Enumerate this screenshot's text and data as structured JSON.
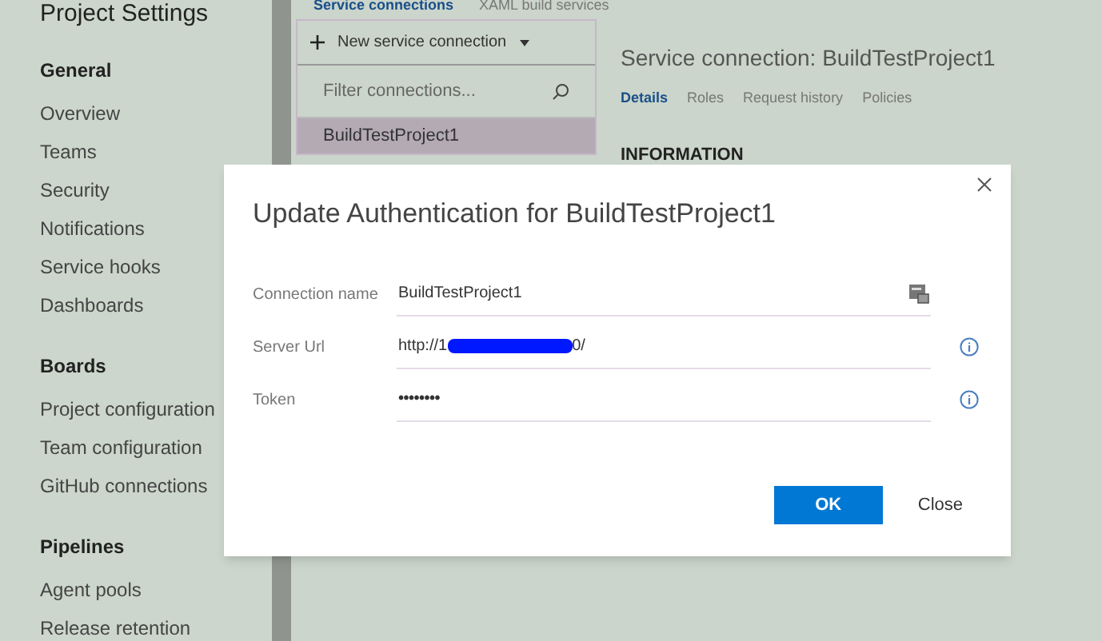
{
  "sidebar": {
    "title": "Project Settings",
    "sections": [
      {
        "heading": "General",
        "items": [
          "Overview",
          "Teams",
          "Security",
          "Notifications",
          "Service hooks",
          "Dashboards"
        ]
      },
      {
        "heading": "Boards",
        "items": [
          "Project configuration",
          "Team configuration",
          "GitHub connections"
        ]
      },
      {
        "heading": "Pipelines",
        "items": [
          "Agent pools",
          "Release retention"
        ]
      }
    ]
  },
  "top_tabs": [
    {
      "label": "Service connections",
      "selected": true
    },
    {
      "label": "XAML build services",
      "selected": false
    }
  ],
  "connections": {
    "new_button": "New service connection",
    "filter_placeholder": "Filter connections...",
    "items": [
      {
        "name": "BuildTestProject1",
        "selected": true
      }
    ]
  },
  "detail": {
    "title": "Service connection: BuildTestProject1",
    "tabs": [
      {
        "label": "Details",
        "selected": true
      },
      {
        "label": "Roles",
        "selected": false
      },
      {
        "label": "Request history",
        "selected": false
      },
      {
        "label": "Policies",
        "selected": false
      }
    ],
    "section": "INFORMATION"
  },
  "dialog": {
    "title": "Update Authentication for BuildTestProject1",
    "fields": [
      {
        "label": "Connection name",
        "kind": "text",
        "value": "BuildTestProject1"
      },
      {
        "label": "Server Url",
        "kind": "redacted",
        "value_start": "http://1",
        "value_end": "0/"
      },
      {
        "label": "Token",
        "kind": "password",
        "value": "••••••••"
      }
    ],
    "ok": "OK",
    "close": "Close"
  }
}
